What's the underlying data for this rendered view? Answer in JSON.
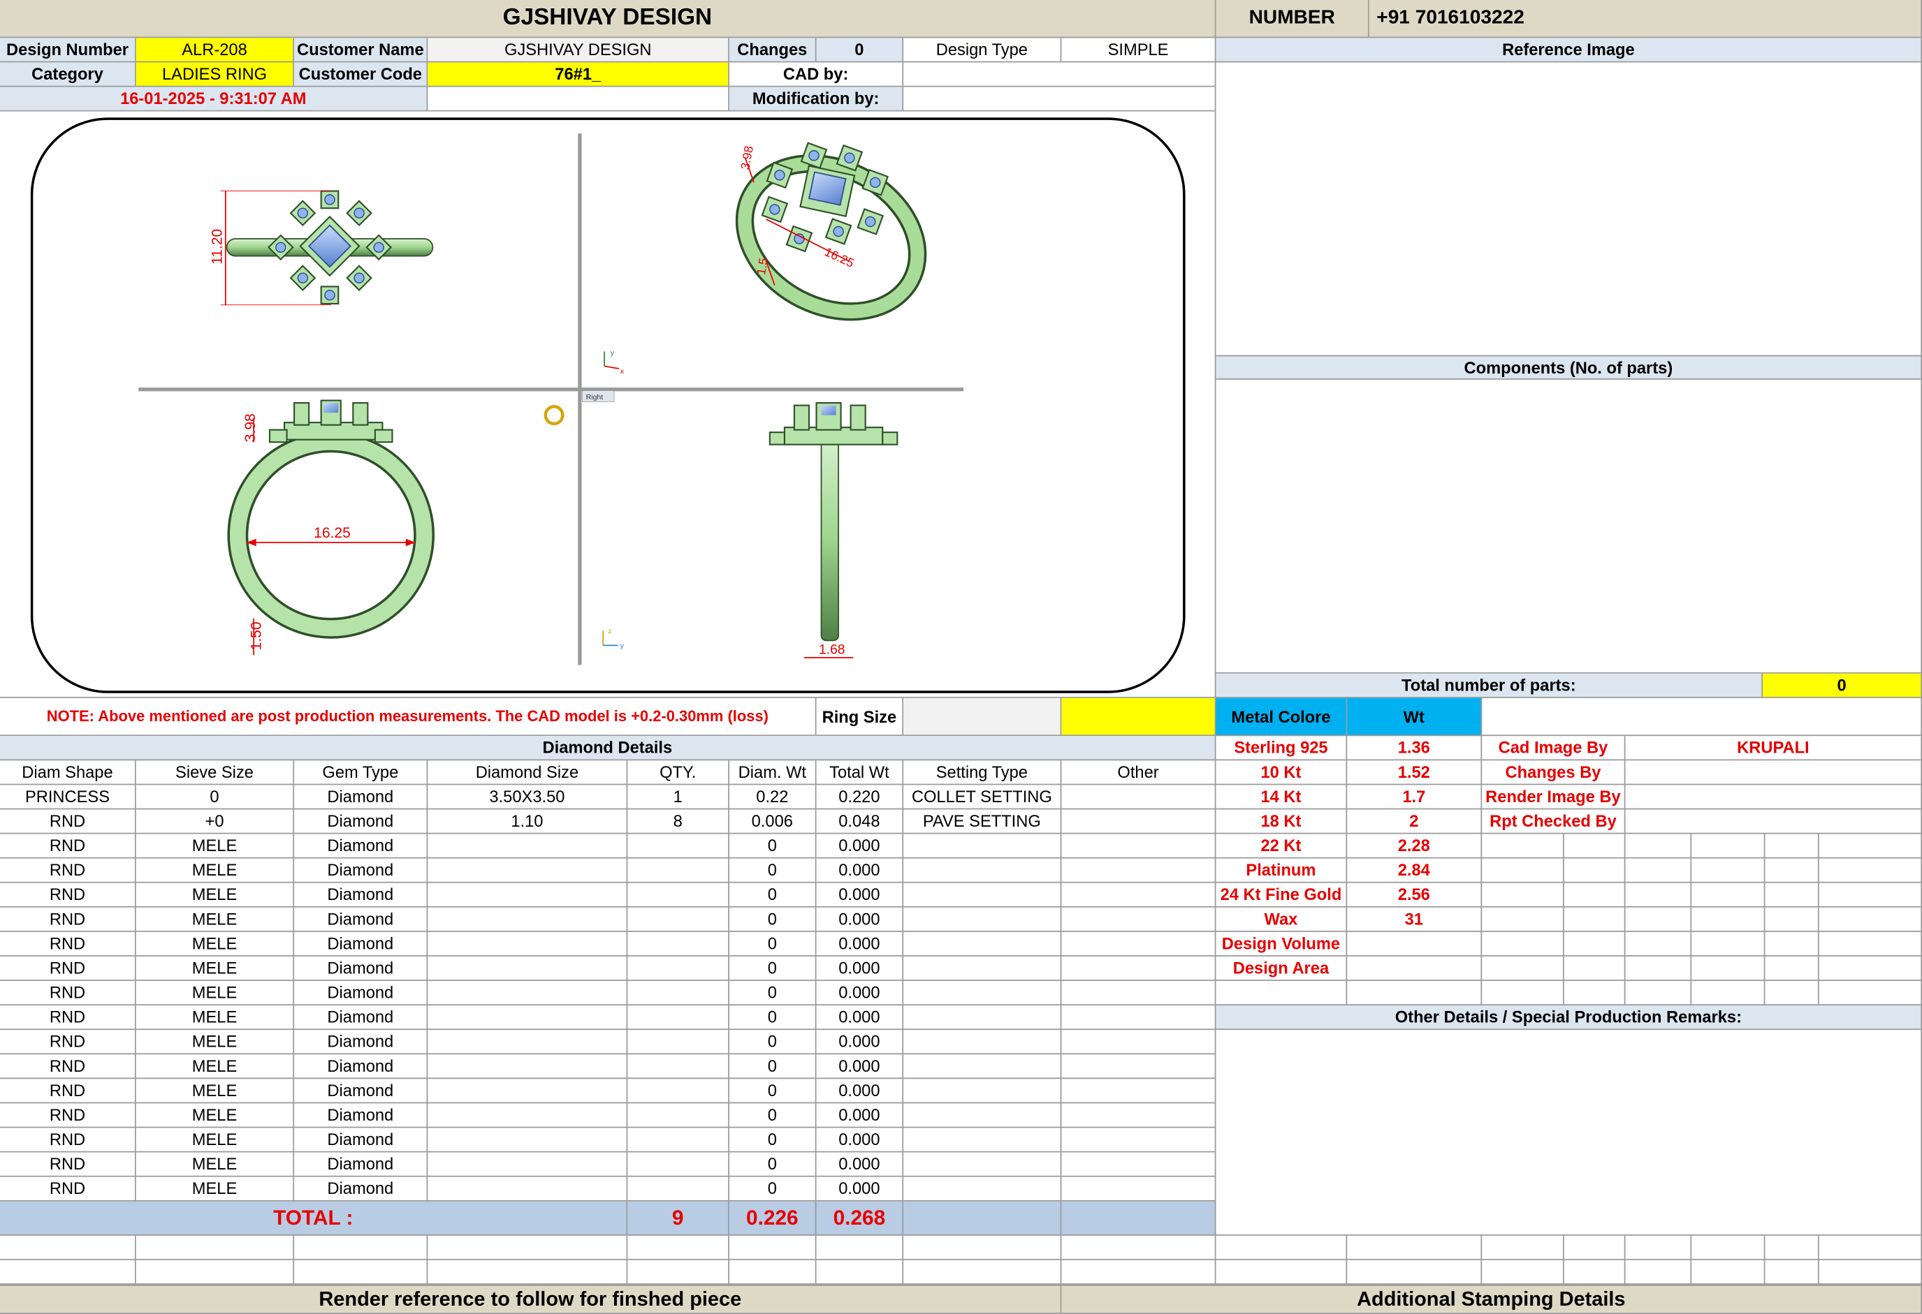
{
  "header": {
    "company": "GJSHIVAY DESIGN",
    "number_label": "NUMBER",
    "number_value": "+91 7016103222"
  },
  "info": {
    "design_number_label": "Design Number",
    "design_number": "ALR-208",
    "customer_name_label": "Customer Name",
    "customer_name": "GJSHIVAY DESIGN",
    "changes_label": "Changes",
    "changes": "0",
    "design_type_label": "Design Type",
    "design_type": "SIMPLE",
    "category_label": "Category",
    "category": "LADIES RING",
    "customer_code_label": "Customer Code",
    "customer_code": "76#1_",
    "cad_by_label": "CAD by:",
    "cad_by": "",
    "date": "16-01-2025 - 9:31:07 AM",
    "modification_by_label": "Modification by:",
    "modification_by": ""
  },
  "reference_image_label": "Reference Image",
  "components_label": "Components (No. of parts)",
  "total_parts_label": "Total number of parts:",
  "total_parts": "0",
  "note": "NOTE: Above mentioned are post production measurements. The CAD model is +0.2-0.30mm (loss)",
  "ring_size_label": "Ring Size",
  "ring_size": "",
  "cad": {
    "dim_top": "11.20",
    "dim_persp_a": "3.98",
    "dim_persp_b": "16.25",
    "dim_persp_c": "1.5",
    "dim_front_height": "3.98",
    "dim_front_inner": "16.25",
    "dim_front_band": "1.50",
    "dim_side": "1.68",
    "view_label": "Right",
    "axis_x": "x",
    "axis_y": "y",
    "axis_z": "z"
  },
  "diamond": {
    "title": "Diamond Details",
    "headers": [
      "Diam Shape",
      "Sieve Size",
      "Gem Type",
      "Diamond Size",
      "QTY.",
      "Diam. Wt",
      "Total Wt",
      "Setting Type",
      "Other"
    ],
    "rows": [
      [
        "PRINCESS",
        "0",
        "Diamond",
        "3.50X3.50",
        "1",
        "0.22",
        "0.220",
        "COLLET SETTING",
        ""
      ],
      [
        "RND",
        "+0",
        "Diamond",
        "1.10",
        "8",
        "0.006",
        "0.048",
        "PAVE SETTING",
        ""
      ],
      [
        "RND",
        "MELE",
        "Diamond",
        "",
        "",
        "0",
        "0.000",
        "",
        ""
      ],
      [
        "RND",
        "MELE",
        "Diamond",
        "",
        "",
        "0",
        "0.000",
        "",
        ""
      ],
      [
        "RND",
        "MELE",
        "Diamond",
        "",
        "",
        "0",
        "0.000",
        "",
        ""
      ],
      [
        "RND",
        "MELE",
        "Diamond",
        "",
        "",
        "0",
        "0.000",
        "",
        ""
      ],
      [
        "RND",
        "MELE",
        "Diamond",
        "",
        "",
        "0",
        "0.000",
        "",
        ""
      ],
      [
        "RND",
        "MELE",
        "Diamond",
        "",
        "",
        "0",
        "0.000",
        "",
        ""
      ],
      [
        "RND",
        "MELE",
        "Diamond",
        "",
        "",
        "0",
        "0.000",
        "",
        ""
      ],
      [
        "RND",
        "MELE",
        "Diamond",
        "",
        "",
        "0",
        "0.000",
        "",
        ""
      ],
      [
        "RND",
        "MELE",
        "Diamond",
        "",
        "",
        "0",
        "0.000",
        "",
        ""
      ],
      [
        "RND",
        "MELE",
        "Diamond",
        "",
        "",
        "0",
        "0.000",
        "",
        ""
      ],
      [
        "RND",
        "MELE",
        "Diamond",
        "",
        "",
        "0",
        "0.000",
        "",
        ""
      ],
      [
        "RND",
        "MELE",
        "Diamond",
        "",
        "",
        "0",
        "0.000",
        "",
        ""
      ],
      [
        "RND",
        "MELE",
        "Diamond",
        "",
        "",
        "0",
        "0.000",
        "",
        ""
      ],
      [
        "RND",
        "MELE",
        "Diamond",
        "",
        "",
        "0",
        "0.000",
        "",
        ""
      ],
      [
        "RND",
        "MELE",
        "Diamond",
        "",
        "",
        "0",
        "0.000",
        "",
        ""
      ]
    ],
    "total_label": "TOTAL :",
    "total_qty": "9",
    "total_diam_wt": "0.226",
    "total_wt": "0.268"
  },
  "metal": {
    "header": "Metal Colore",
    "wt_header": "Wt",
    "rows": [
      [
        "Sterling 925",
        "1.36"
      ],
      [
        "10 Kt",
        "1.52"
      ],
      [
        "14 Kt",
        "1.7"
      ],
      [
        "18 Kt",
        "2"
      ],
      [
        "22 Kt",
        "2.28"
      ],
      [
        "Platinum",
        "2.84"
      ],
      [
        "24 Kt Fine Gold",
        "2.56"
      ],
      [
        "Wax",
        "31"
      ],
      [
        "Design Volume",
        ""
      ],
      [
        "Design Area",
        ""
      ]
    ]
  },
  "credits": [
    [
      "Cad Image By",
      "KRUPALI"
    ],
    [
      "Changes By",
      ""
    ],
    [
      "Render Image By",
      ""
    ],
    [
      "Rpt Checked By",
      ""
    ]
  ],
  "other_details_label": "Other Details / Special Production Remarks:",
  "footer": {
    "render_ref": "Render reference to follow for finshed piece",
    "stamping": "Additional Stamping Details"
  },
  "colors": {
    "yellow": "#ffff00",
    "header_tan": "#ddd9c4",
    "label_blue": "#dce6f1",
    "metal_blue": "#00b0f0",
    "total_blue": "#b8cce4",
    "text_red": "#e60000",
    "ring_green": "#b6e3a9",
    "gem_blue": "#7fa7e6"
  }
}
